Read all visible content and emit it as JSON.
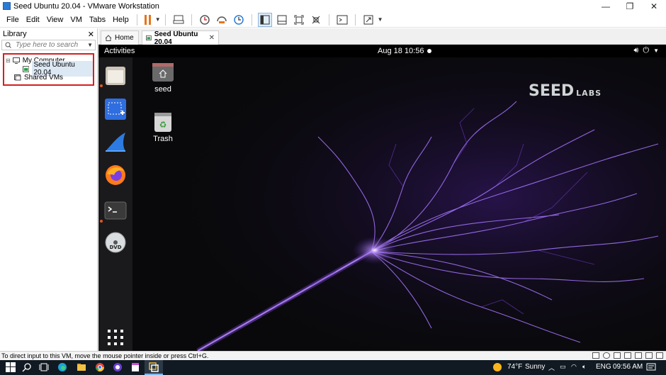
{
  "window": {
    "title": "Seed Ubuntu 20.04 - VMware Workstation",
    "controls": {
      "minimize": "—",
      "restore": "❐",
      "close": "✕"
    }
  },
  "menu": [
    "File",
    "Edit",
    "View",
    "VM",
    "Tabs",
    "Help"
  ],
  "library": {
    "title": "Library",
    "close": "✕",
    "search_placeholder": "Type here to search",
    "tree": {
      "root": "My Computer",
      "child": "Seed Ubuntu 20.04",
      "shared": "Shared VMs"
    }
  },
  "tabs": {
    "home": "Home",
    "active": "Seed Ubuntu 20.04",
    "close": "✕"
  },
  "guest": {
    "activities": "Activities",
    "clock": "Aug 18  10:56",
    "logo_main": "SEED",
    "logo_sub": "LABS",
    "desktop": {
      "home_label": "seed",
      "trash_label": "Trash"
    },
    "colors": {
      "accent": "#e95420",
      "lightning": "#9b5cf5"
    }
  },
  "statusbar": {
    "hint": "To direct input to this VM, move the mouse pointer inside or press Ctrl+G."
  },
  "taskbar": {
    "weather_temp": "74°F",
    "weather_text": "Sunny",
    "lang": "ENG",
    "time": "09:56 AM"
  }
}
